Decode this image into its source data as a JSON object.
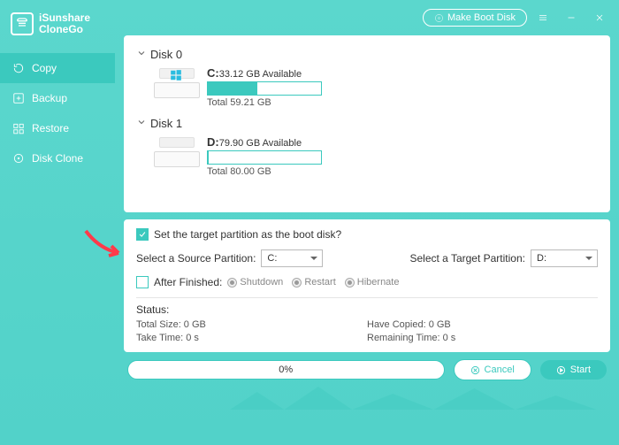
{
  "app": {
    "name_line1": "iSunshare",
    "name_line2": "CloneGo"
  },
  "titlebar": {
    "make_boot": "Make Boot Disk"
  },
  "sidebar": {
    "items": [
      {
        "label": "Copy",
        "active": true
      },
      {
        "label": "Backup",
        "active": false
      },
      {
        "label": "Restore",
        "active": false
      },
      {
        "label": "Disk Clone",
        "active": false
      }
    ]
  },
  "disks": [
    {
      "title": "Disk 0",
      "letter": "C:",
      "avail": "33.12 GB Available",
      "total": "Total 59.21 GB",
      "fill_pct": 44,
      "win": true
    },
    {
      "title": "Disk 1",
      "letter": "D:",
      "avail": "79.90 GB Available",
      "total": "Total 80.00 GB",
      "fill_pct": 1,
      "win": false
    }
  ],
  "cfg": {
    "boot_chk_checked": true,
    "boot_chk_label": "Set the target partition as the boot disk?",
    "src_label": "Select a Source Partition:",
    "src_value": "C:",
    "tgt_label": "Select a Target Partition:",
    "tgt_value": "D:",
    "after_chk_checked": false,
    "after_label": "After Finished:",
    "radios": [
      "Shutdown",
      "Restart",
      "Hibernate"
    ]
  },
  "status": {
    "title": "Status:",
    "total": "Total Size: 0 GB",
    "copied": "Have Copied: 0 GB",
    "take": "Take Time: 0 s",
    "remain": "Remaining Time: 0 s"
  },
  "bottom": {
    "progress": "0%",
    "cancel": "Cancel",
    "start": "Start"
  }
}
